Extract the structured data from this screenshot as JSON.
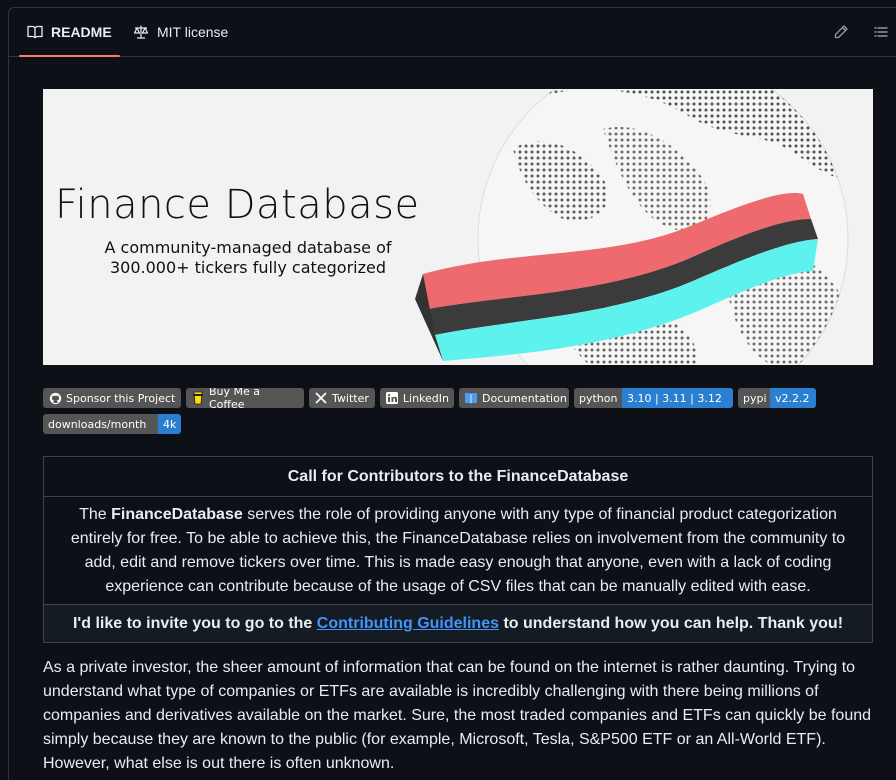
{
  "tabs": [
    {
      "label": "README",
      "icon": "book-icon",
      "active": true
    },
    {
      "label": "MIT license",
      "icon": "scale-icon",
      "active": false
    }
  ],
  "toolbar": {
    "edit_icon": "pencil-icon",
    "outline_icon": "list-icon"
  },
  "banner": {
    "title": "Finance Database",
    "subtitle_line1": "A community-managed database of",
    "subtitle_line2": "300.000+ tickers fully categorized"
  },
  "badges": [
    {
      "icon": "github-icon",
      "label": "Sponsor this Project",
      "value": ""
    },
    {
      "icon": "coffee-icon",
      "label": "Buy Me a Coffee",
      "value": ""
    },
    {
      "icon": "x-icon",
      "label": "Twitter",
      "value": ""
    },
    {
      "icon": "linkedin-icon",
      "label": "LinkedIn",
      "value": ""
    },
    {
      "icon": "book-icon",
      "label": "Documentation",
      "value": ""
    },
    {
      "icon": "",
      "label": "python",
      "value": "3.10 | 3.11 | 3.12"
    },
    {
      "icon": "",
      "label": "pypi",
      "value": "v2.2.2"
    },
    {
      "icon": "",
      "label": "downloads/month",
      "value": "4k"
    }
  ],
  "contrib": {
    "heading": "Call for Contributors to the FinanceDatabase",
    "body_pre": "The ",
    "body_bold": "FinanceDatabase",
    "body_post": " serves the role of providing anyone with any type of financial product categorization entirely for free. To be able to achieve this, the FinanceDatabase relies on involvement from the community to add, edit and remove tickers over time. This is made easy enough that anyone, even with a lack of coding experience can contribute because of the usage of CSV files that can be manually edited with ease.",
    "invite_pre": "I'd like to invite you to go to the ",
    "invite_link": "Contributing Guidelines",
    "invite_post": " to understand how you can help. Thank you!"
  },
  "paragraph": "As a private investor, the sheer amount of information that can be found on the internet is rather daunting. Trying to understand what type of companies or ETFs are available is incredibly challenging with there being millions of companies and derivatives available on the market. Sure, the most traded companies and ETFs can quickly be found simply because they are known to the public (for example, Microsoft, Tesla, S&P500 ETF or an All-World ETF). However, what else is out there is often unknown."
}
